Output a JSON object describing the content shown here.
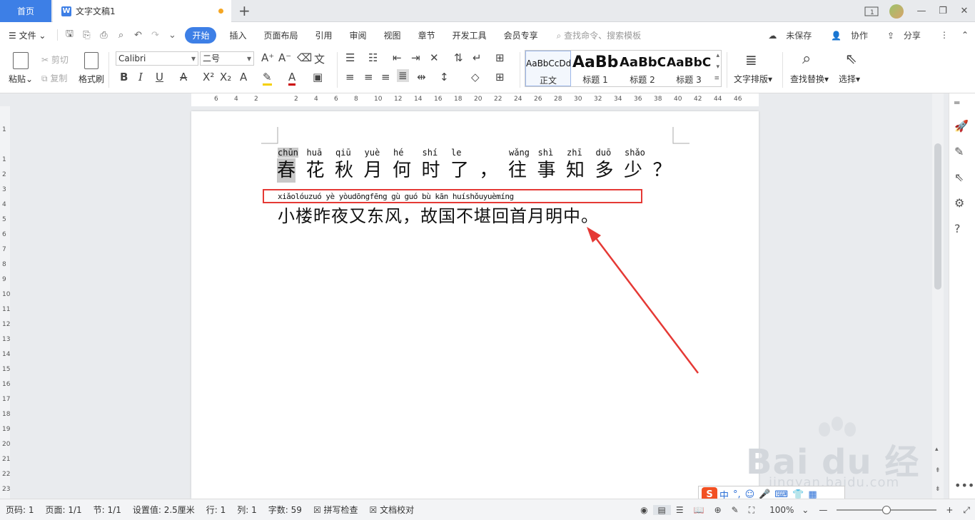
{
  "titlebar": {
    "home_tab": "首页",
    "doc_tab": "文字文稿1",
    "doc_icon": "W",
    "new_tab": "+",
    "page_indicator": "1"
  },
  "menu": {
    "file": "文件",
    "tabs": [
      "开始",
      "插入",
      "页面布局",
      "引用",
      "审阅",
      "视图",
      "章节",
      "开发工具",
      "会员专享"
    ],
    "search_placeholder": "查找命令、搜索模板",
    "unsaved": "未保存",
    "collab": "协作",
    "share": "分享"
  },
  "ribbon": {
    "paste": "粘贴",
    "cut": "剪切",
    "copy": "复制",
    "format_painter": "格式刷",
    "font_name": "Calibri",
    "font_size": "二号",
    "styles": [
      {
        "preview": "AaBbCcDd",
        "label": "正文"
      },
      {
        "preview": "AaBb",
        "label": "标题 1"
      },
      {
        "preview": "AaBbC",
        "label": "标题 2"
      },
      {
        "preview": "AaBbC",
        "label": "标题 3"
      }
    ],
    "text_layout": "文字排版",
    "find_replace": "查找替换",
    "select": "选择"
  },
  "ruler": {
    "h_marks": [
      "6",
      "4",
      "2",
      "",
      "2",
      "4",
      "6",
      "8",
      "10",
      "12",
      "14",
      "16",
      "18",
      "20",
      "22",
      "24",
      "26",
      "28",
      "30",
      "32",
      "34",
      "36",
      "38",
      "40",
      "42",
      "44",
      "46"
    ],
    "v_marks": [
      "1",
      "",
      "1",
      "2",
      "3",
      "4",
      "5",
      "6",
      "7",
      "8",
      "9",
      "10",
      "11",
      "12",
      "13",
      "14",
      "15",
      "16",
      "17",
      "18",
      "19",
      "20",
      "21",
      "22",
      "23"
    ]
  },
  "document": {
    "line1_pinyin": [
      "chūn",
      "huā",
      "qiū",
      "yuè",
      "hé",
      "shí",
      "le",
      "",
      "wǎng",
      "shì",
      "zhī",
      "duō",
      "shǎo",
      ""
    ],
    "line1_chars": [
      "春",
      "花",
      "秋",
      "月",
      "何",
      "时",
      "了",
      "，",
      "往",
      "事",
      "知",
      "多",
      "少",
      "？"
    ],
    "line2_pinyin": "xiǎolóuzuó yè yòudōngfēng  gù guó bù kān huíshǒuyuèmíng",
    "line2_text": "小楼昨夜又东风，故国不堪回首月明中。"
  },
  "ime": {
    "logo": "S",
    "mode": "中"
  },
  "watermark": {
    "brand": "Bai  du 经验",
    "url": "jingyan.baidu.com"
  },
  "status": {
    "page_no": "页码: 1",
    "pages": "页面: 1/1",
    "section": "节: 1/1",
    "setting": "设置值: 2.5厘米",
    "row": "行: 1",
    "col": "列: 1",
    "word_count": "字数: 59",
    "spell_check": "拼写检查",
    "doc_proof": "文档校对",
    "zoom": "100%"
  },
  "colors": {
    "accent": "#3d7fe6",
    "annotation": "#e53935"
  }
}
